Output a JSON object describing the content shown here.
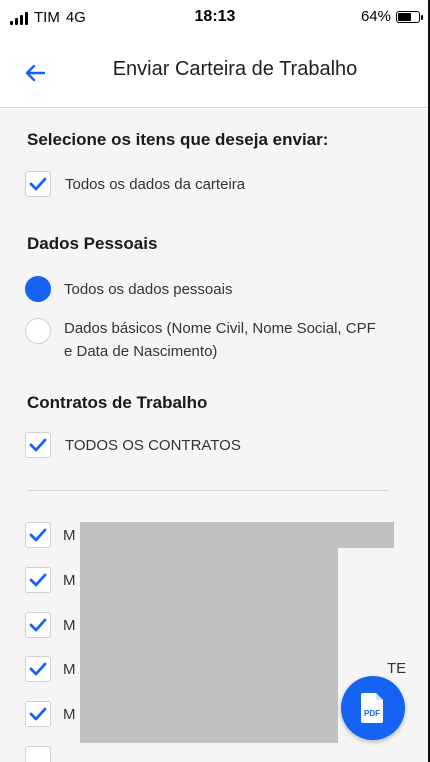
{
  "status_bar": {
    "carrier": "TIM",
    "network": "4G",
    "time": "18:13",
    "battery": "64%",
    "battery_level": 0.64
  },
  "header": {
    "back_icon": "arrow-left-icon",
    "title": "Enviar Carteira de Trabalho"
  },
  "main": {
    "select_title": "Selecione os itens que deseja enviar:",
    "all_data_label": "Todos os dados da carteira",
    "personal": {
      "title": "Dados Pessoais",
      "option_all": "Todos os dados pessoais",
      "option_basic_line1": "Dados básicos (Nome Civil, Nome Social, CPF",
      "option_basic_line2": "e Data de Nascimento)",
      "selected": "option_all"
    },
    "contracts": {
      "title": "Contratos de Trabalho",
      "all_label": "TODOS OS CONTRATOS",
      "items": [
        {
          "label": "M",
          "checked": true
        },
        {
          "label": "M",
          "checked": true
        },
        {
          "label": "M",
          "checked": true
        },
        {
          "label": "M",
          "checked": true,
          "suffix": "TE"
        },
        {
          "label": "M",
          "checked": true
        }
      ]
    }
  },
  "fab": {
    "icon": "pdf-file-icon",
    "label": "PDF"
  },
  "colors": {
    "accent": "#1463f3",
    "background": "#f5f5f5",
    "redaction": "#c1c1c1"
  }
}
